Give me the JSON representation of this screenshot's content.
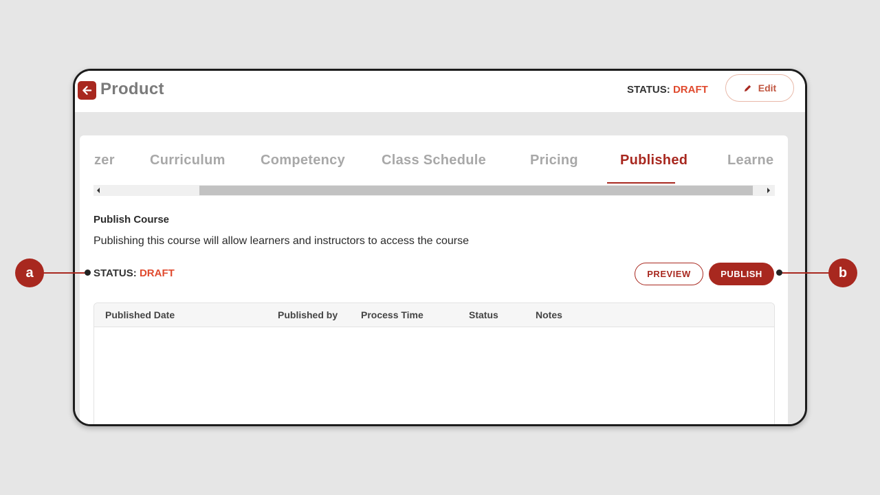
{
  "header": {
    "title": "Product",
    "status_label": "STATUS:",
    "status_value": "DRAFT",
    "edit_label": "Edit"
  },
  "tabs": [
    {
      "label": "zer"
    },
    {
      "label": "Curriculum"
    },
    {
      "label": "Competency"
    },
    {
      "label": "Class Schedule"
    },
    {
      "label": "Pricing"
    },
    {
      "label": "Published",
      "active": true
    },
    {
      "label": "Learne"
    }
  ],
  "publish_section": {
    "title": "Publish Course",
    "description": "Publishing this course will allow learners and instructors to access the course",
    "status_label": "STATUS:",
    "status_value": "DRAFT",
    "preview_label": "PREVIEW",
    "publish_label": "PUBLISH"
  },
  "table": {
    "columns": [
      "Published Date",
      "Published by",
      "Process Time",
      "Status",
      "Notes"
    ],
    "rows": []
  },
  "callouts": {
    "a": "a",
    "b": "b"
  },
  "colors": {
    "brand": "#a8281f",
    "status_draft": "#e04a2e",
    "background": "#e6e6e6"
  }
}
